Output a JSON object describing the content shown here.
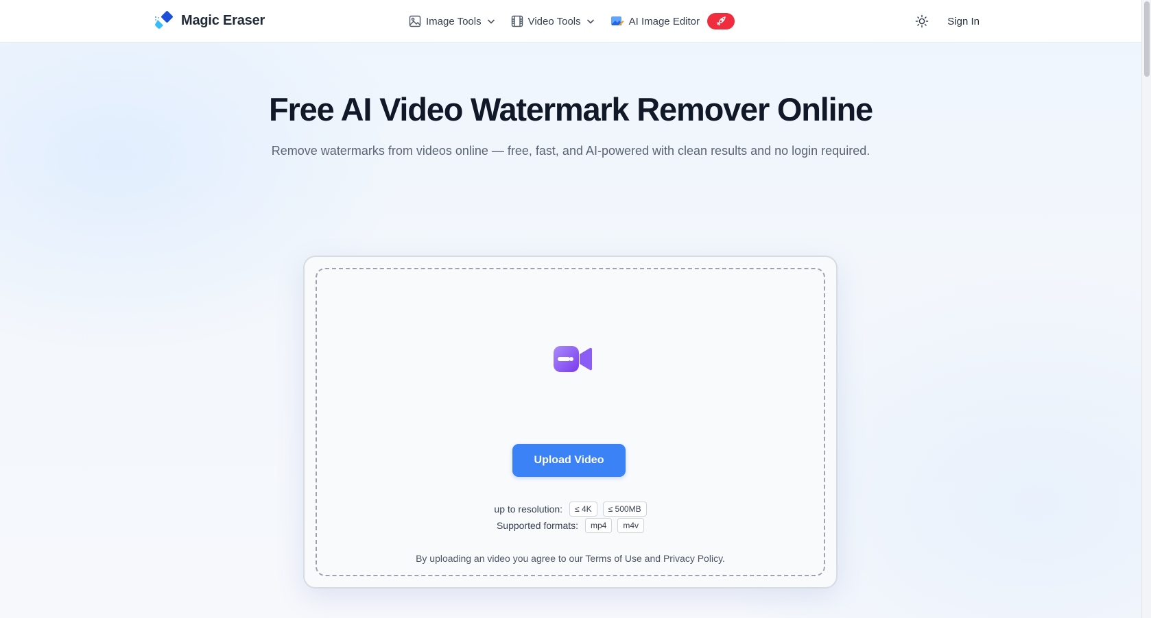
{
  "header": {
    "brand": "Magic Eraser",
    "nav": {
      "image_tools": "Image Tools",
      "video_tools": "Video Tools",
      "ai_image_editor": "AI Image Editor"
    },
    "sign_in": "Sign In"
  },
  "hero": {
    "title": "Free AI Video Watermark Remover Online",
    "subtitle": "Remove watermarks from videos online — free, fast, and AI-powered with clean results and no login required."
  },
  "upload": {
    "button_label": "Upload Video",
    "resolution_label": "up to resolution:",
    "resolution_chips": [
      "≤ 4K",
      "≤ 500MB"
    ],
    "formats_label": "Supported formats:",
    "format_chips": [
      "mp4",
      "m4v"
    ],
    "agree_prefix": "By uploading an video you agree to our ",
    "terms_link": "Terms of Use",
    "agree_and": " and ",
    "privacy_link": "Privacy Policy",
    "agree_suffix": "."
  },
  "icons": {
    "logo": "eraser-logo-icon",
    "image_tools": "image-icon",
    "video_tools": "film-icon",
    "ai_image_editor": "ai-editor-icon",
    "hot_badge": "rocket-icon",
    "theme": "sun-icon",
    "upload": "video-camera-icon"
  },
  "colors": {
    "primary": "#3b82f6",
    "hot_badge": "#ef2d3f",
    "upload_icon": "#8b5cf6"
  }
}
